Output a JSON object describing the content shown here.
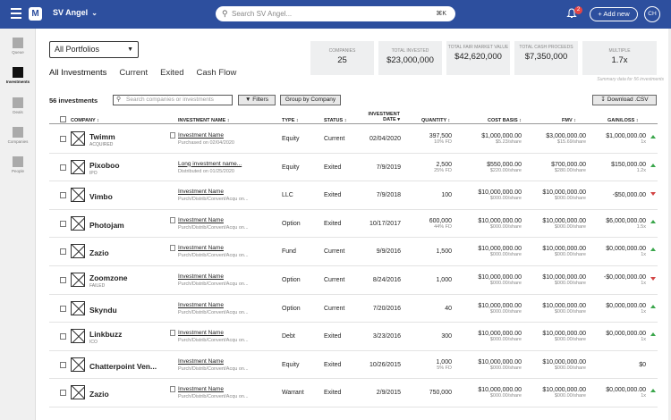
{
  "app": {
    "org": "SV Angel",
    "search_placeholder": "Search SV Angel...",
    "search_shortcut": "⌘K",
    "notifications": "2",
    "add_new": "+ Add new",
    "avatar": "CH",
    "logo": "M"
  },
  "nav": [
    {
      "label": "Queue"
    },
    {
      "label": "Investments"
    },
    {
      "label": "Deals"
    },
    {
      "label": "Companies"
    },
    {
      "label": "People"
    }
  ],
  "portfolio": "All Portfolios",
  "tabs": [
    "All Investments",
    "Current",
    "Exited",
    "Cash Flow"
  ],
  "summary": {
    "cards": [
      {
        "title": "COMPANIES",
        "value": "25"
      },
      {
        "title": "TOTAL INVESTED",
        "value": "$23,000,000"
      },
      {
        "title": "TOTAL FAIR MARKET VALUE",
        "value": "$42,620,000"
      },
      {
        "title": "TOTAL CASH PROCEEDS",
        "value": "$7,350,000"
      },
      {
        "title": "MULTIPLE",
        "value": "1.7x"
      }
    ],
    "note": "Summary data for 56 investments"
  },
  "table": {
    "count": "56 investments",
    "search_placeholder": "Search companies or investments",
    "filters": "Filters",
    "group": "Group by Company",
    "download": "Download .CSV",
    "headers": {
      "company": "COMPANY ↕",
      "investment": "INVESTMENT NAME ↕",
      "type": "TYPE ↕",
      "status": "STATUS ↕",
      "date": "INVESTMENT DATE ▾",
      "quantity": "QUANTITY ↕",
      "cost": "COST BASIS ↕",
      "fmv": "FMV ↕",
      "gain": "GAIN/LOSS ↕"
    },
    "rows": [
      {
        "company": "Twimm",
        "csub": "ACQUIRED",
        "name": "Investment Name",
        "nsub": "Purchased on 02/04/2020",
        "type": "Equity",
        "status": "Current",
        "date": "02/04/2020",
        "qty": "397,500",
        "qsub": "10% FD",
        "cost": "$1,000,000.00",
        "csh": "$5.23/share",
        "fmv": "$3,000,000.00",
        "fsh": "$15.69/share",
        "gain": "$1,000,000.00",
        "gx": "1x",
        "dir": "up"
      },
      {
        "company": "Pixoboo",
        "csub": "IPO",
        "name": "Long investment name...",
        "nsub": "Distributed on 01/25/2020",
        "type": "Equity",
        "status": "Exited",
        "date": "7/9/2019",
        "qty": "2,500",
        "qsub": "25% FD",
        "cost": "$550,000.00",
        "csh": "$220.00/share",
        "fmv": "$700,000.00",
        "fsh": "$280.00/share",
        "gain": "$150,000.00",
        "gx": "1.2x",
        "dir": "up"
      },
      {
        "company": "Vimbo",
        "csub": "",
        "name": "Investment Name",
        "nsub": "Purch/Distrib/Convert/Acqu on...",
        "type": "LLC",
        "status": "Exited",
        "date": "7/9/2018",
        "qty": "100",
        "qsub": "",
        "cost": "$10,000,000.00",
        "csh": "$000.00/share",
        "fmv": "$10,000,000.00",
        "fsh": "$000.00/share",
        "gain": "-$50,000.00",
        "gx": "",
        "dir": "dn"
      },
      {
        "company": "Photojam",
        "csub": "",
        "name": "Investment Name",
        "nsub": "Purch/Distrib/Convert/Acqu on...",
        "type": "Option",
        "status": "Exited",
        "date": "10/17/2017",
        "qty": "600,000",
        "qsub": "44% FD",
        "cost": "$10,000,000.00",
        "csh": "$000.00/share",
        "fmv": "$10,000,000.00",
        "fsh": "$000.00/share",
        "gain": "$6,000,000.00",
        "gx": "1.5x",
        "dir": "up"
      },
      {
        "company": "Zazio",
        "csub": "",
        "name": "Investment Name",
        "nsub": "Purch/Distrib/Convert/Acqu on...",
        "type": "Fund",
        "status": "Current",
        "date": "9/9/2016",
        "qty": "1,500",
        "qsub": "",
        "cost": "$10,000,000.00",
        "csh": "$000.00/share",
        "fmv": "$10,000,000.00",
        "fsh": "$000.00/share",
        "gain": "$0,000,000.00",
        "gx": "1x",
        "dir": "up"
      },
      {
        "company": "Zoomzone",
        "csub": "FAILED",
        "name": "Investment Name",
        "nsub": "Purch/Distrib/Convert/Acqu on...",
        "type": "Option",
        "status": "Current",
        "date": "8/24/2016",
        "qty": "1,000",
        "qsub": "",
        "cost": "$10,000,000.00",
        "csh": "$000.00/share",
        "fmv": "$10,000,000.00",
        "fsh": "$000.00/share",
        "gain": "-$0,000,000.00",
        "gx": "1x",
        "dir": "dn"
      },
      {
        "company": "Skyndu",
        "csub": "",
        "name": "Investment Name",
        "nsub": "Purch/Distrib/Convert/Acqu on...",
        "type": "Option",
        "status": "Current",
        "date": "7/20/2016",
        "qty": "40",
        "qsub": "",
        "cost": "$10,000,000.00",
        "csh": "$000.00/share",
        "fmv": "$10,000,000.00",
        "fsh": "$000.00/share",
        "gain": "$0,000,000.00",
        "gx": "1x",
        "dir": "up"
      },
      {
        "company": "Linkbuzz",
        "csub": "ICO",
        "name": "Investment Name",
        "nsub": "Purch/Distrib/Convert/Acqu on...",
        "type": "Debt",
        "status": "Exited",
        "date": "3/23/2016",
        "qty": "300",
        "qsub": "",
        "cost": "$10,000,000.00",
        "csh": "$000.00/share",
        "fmv": "$10,000,000.00",
        "fsh": "$000.00/share",
        "gain": "$0,000,000.00",
        "gx": "1x",
        "dir": "up"
      },
      {
        "company": "Chatterpoint Ven...",
        "csub": "",
        "name": "Investment Name",
        "nsub": "Purch/Distrib/Convert/Acqu on...",
        "type": "Equity",
        "status": "Exited",
        "date": "10/26/2015",
        "qty": "1,000",
        "qsub": "5% FD",
        "cost": "$10,000,000.00",
        "csh": "$000.00/share",
        "fmv": "$10,000,000.00",
        "fsh": "$000.00/share",
        "gain": "$0",
        "gx": "",
        "dir": ""
      },
      {
        "company": "Zazio",
        "csub": "",
        "name": "Investment Name",
        "nsub": "Purch/Distrib/Convert/Acqu on...",
        "type": "Warrant",
        "status": "Exited",
        "date": "2/9/2015",
        "qty": "750,000",
        "qsub": "",
        "cost": "$10,000,000.00",
        "csh": "$000.00/share",
        "fmv": "$10,000,000.00",
        "fsh": "$000.00/share",
        "gain": "$0,000,000.00",
        "gx": "1x",
        "dir": "up"
      }
    ]
  }
}
